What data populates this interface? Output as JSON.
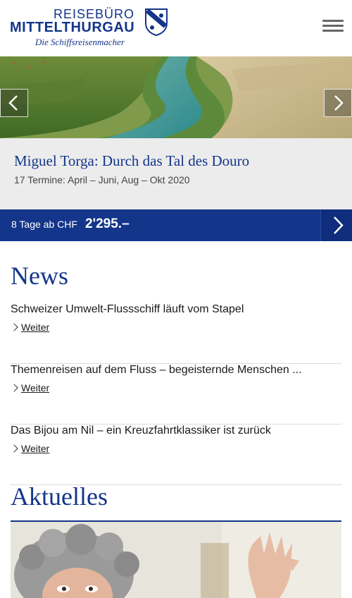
{
  "header": {
    "logo_line1": "REISEBÜRO",
    "logo_line2": "MITTELTHURGAU",
    "logo_tagline": "Die Schiffsreisenmacher",
    "menu_icon": "hamburger-menu-icon"
  },
  "hero": {
    "image": "douro-valley-river-landscape",
    "prev_icon": "chevron-left-icon",
    "next_icon": "chevron-right-icon"
  },
  "trip": {
    "title": "Miguel Torga: Durch das Tal des Douro",
    "dates": "17 Termine: April – Juni, Aug – Okt 2020"
  },
  "price_bar": {
    "prefix": "8 Tage ab CHF",
    "amount": "2'295.–",
    "arrow_icon": "chevron-right-icon"
  },
  "news": {
    "heading": "News",
    "items": [
      {
        "title": "Schweizer Umwelt-Flussschiff läuft vom Stapel",
        "link": "Weiter"
      },
      {
        "title": "Themenreisen auf dem Fluss – begeisternde Menschen ...",
        "link": "Weiter"
      },
      {
        "title": "Das Bijou am Nil – ein Kreuzfahrtklassiker ist zurück",
        "link": "Weiter"
      }
    ]
  },
  "aktuelles": {
    "heading": "Aktuelles",
    "image": "woman-with-grey-curly-hair-photo"
  },
  "colors": {
    "brand_blue": "#13358a",
    "light_grey": "#ececec"
  }
}
